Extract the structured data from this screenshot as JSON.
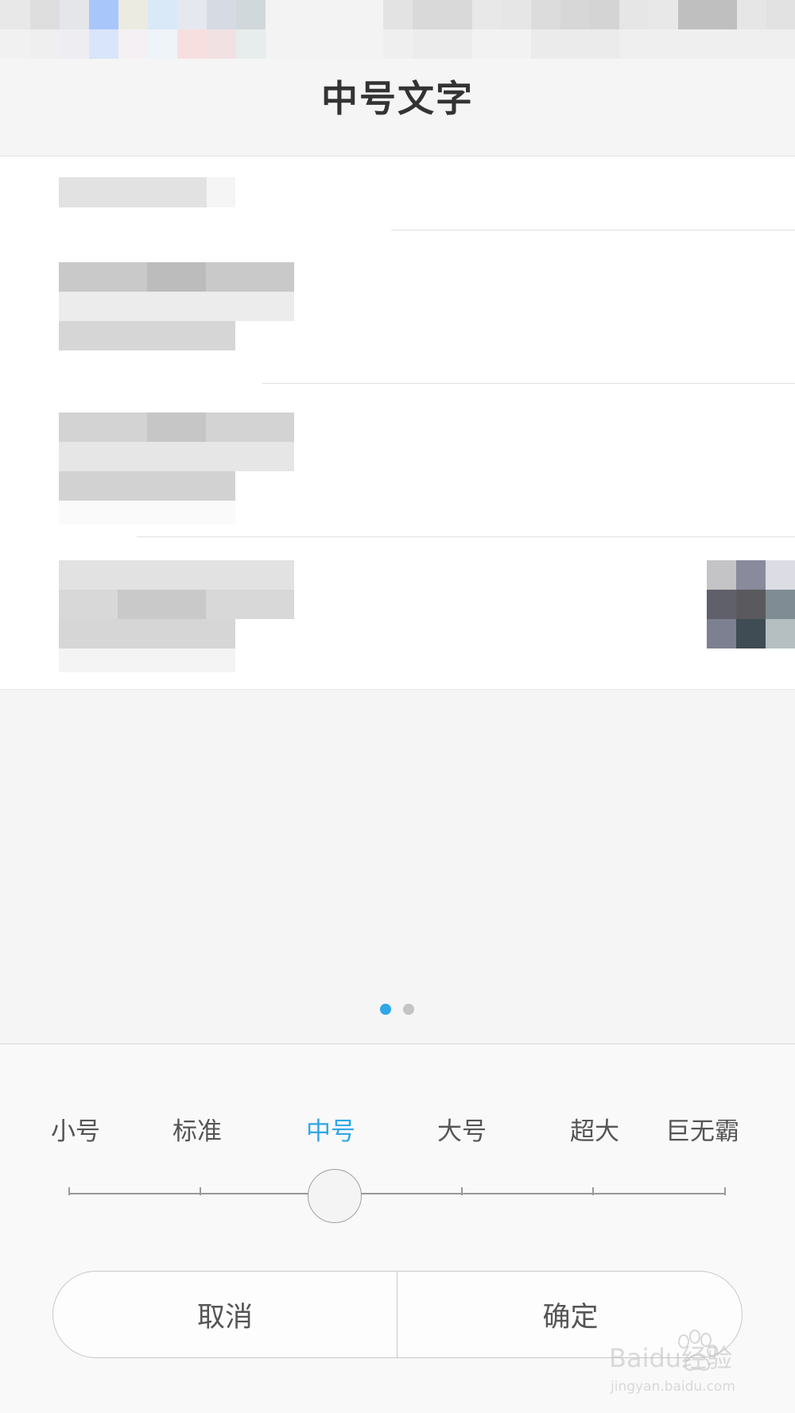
{
  "page": {
    "title": "中号文字"
  },
  "pager": {
    "active_index": 0,
    "count": 2,
    "active_color": "#2ea7e8",
    "inactive_color": "#c4c4c4"
  },
  "font_size": {
    "options": [
      "小号",
      "标准",
      "中号",
      "大号",
      "超大",
      "巨无霸"
    ],
    "selected": "中号",
    "selected_index": 2,
    "accent_color": "#2ea7e8"
  },
  "actions": {
    "cancel_label": "取消",
    "confirm_label": "确定"
  },
  "watermark": {
    "text_main": "Baidu经验",
    "text_sub": "jingyan.baidu.com"
  }
}
